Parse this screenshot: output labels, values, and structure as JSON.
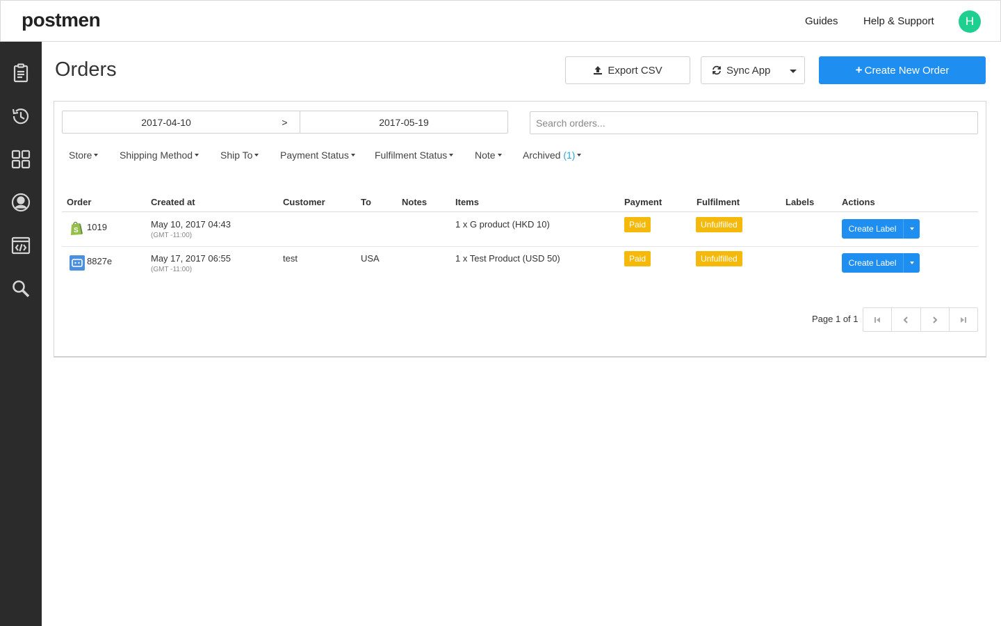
{
  "app": {
    "logo": "postmen",
    "avatar_initial": "H"
  },
  "topnav": {
    "guides": "Guides",
    "help": "Help & Support"
  },
  "sidebar": {
    "icons": [
      "clipboard-icon",
      "history-icon",
      "apps-grid-icon",
      "user-circle-icon",
      "code-window-icon",
      "search-icon"
    ]
  },
  "page": {
    "title": "Orders",
    "export_label": "Export CSV",
    "sync_label": "Sync App",
    "create_label": "Create New Order"
  },
  "filters": {
    "date_from": "2017-04-10",
    "date_sep": ">",
    "date_to": "2017-05-19",
    "search_placeholder": "Search orders...",
    "store": "Store",
    "shipping_method": "Shipping Method",
    "ship_to": "Ship To",
    "payment_status": "Payment Status",
    "fulfilment_status": "Fulfilment Status",
    "note": "Note",
    "archived": "Archived",
    "archived_count": "(1)"
  },
  "table": {
    "headers": {
      "order": "Order",
      "created_at": "Created at",
      "customer": "Customer",
      "to": "To",
      "notes": "Notes",
      "items": "Items",
      "payment": "Payment",
      "fulfilment": "Fulfilment",
      "labels": "Labels",
      "actions": "Actions"
    },
    "rows": [
      {
        "store_icon": "shopify-icon",
        "order": "1019",
        "created": "May 10, 2017 04:43",
        "timezone": "(GMT -11:00)",
        "customer": "",
        "to": "",
        "notes": "",
        "items": "1 x G product (HKD 10)",
        "payment": "Paid",
        "fulfilment": "Unfulfilled",
        "action": "Create Label"
      },
      {
        "store_icon": "api-bot-icon",
        "order": "8827e",
        "created": "May 17, 2017 06:55",
        "timezone": "(GMT -11:00)",
        "customer": "test",
        "to": "USA",
        "notes": "",
        "items": "1 x Test Product (USD 50)",
        "payment": "Paid",
        "fulfilment": "Unfulfilled",
        "action": "Create Label"
      }
    ]
  },
  "pagination": {
    "text": "Page 1 of 1"
  },
  "colors": {
    "primary": "#1e8ff0",
    "badge": "#f5b90b",
    "sidebar": "#2b2b2b",
    "avatar": "#1fcf8f"
  }
}
